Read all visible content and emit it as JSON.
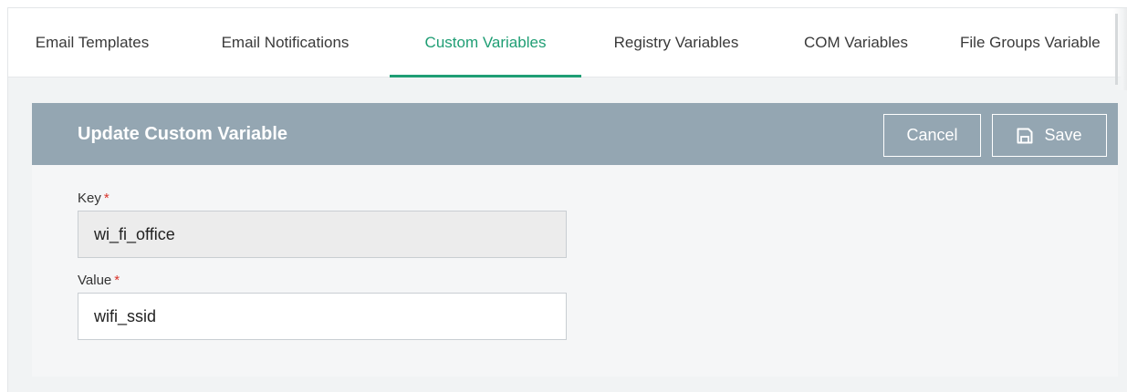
{
  "tabs": [
    {
      "label": "Email Templates",
      "active": false
    },
    {
      "label": "Email Notifications",
      "active": false
    },
    {
      "label": "Custom Variables",
      "active": true
    },
    {
      "label": "Registry Variables",
      "active": false
    },
    {
      "label": "COM Variables",
      "active": false
    },
    {
      "label": "File Groups Variable",
      "active": false
    }
  ],
  "panel": {
    "title": "Update Custom Variable",
    "cancel_label": "Cancel",
    "save_label": "Save",
    "save_icon": "floppy-disk-icon"
  },
  "fields": {
    "key": {
      "label": "Key",
      "required_marker": "*",
      "value": "wi_fi_office",
      "readonly": true
    },
    "value": {
      "label": "Value",
      "required_marker": "*",
      "value": "wifi_ssid",
      "readonly": false
    }
  },
  "colors": {
    "accent": "#1f9e74",
    "header_bg": "#94a6b2",
    "required": "#d9342b"
  }
}
